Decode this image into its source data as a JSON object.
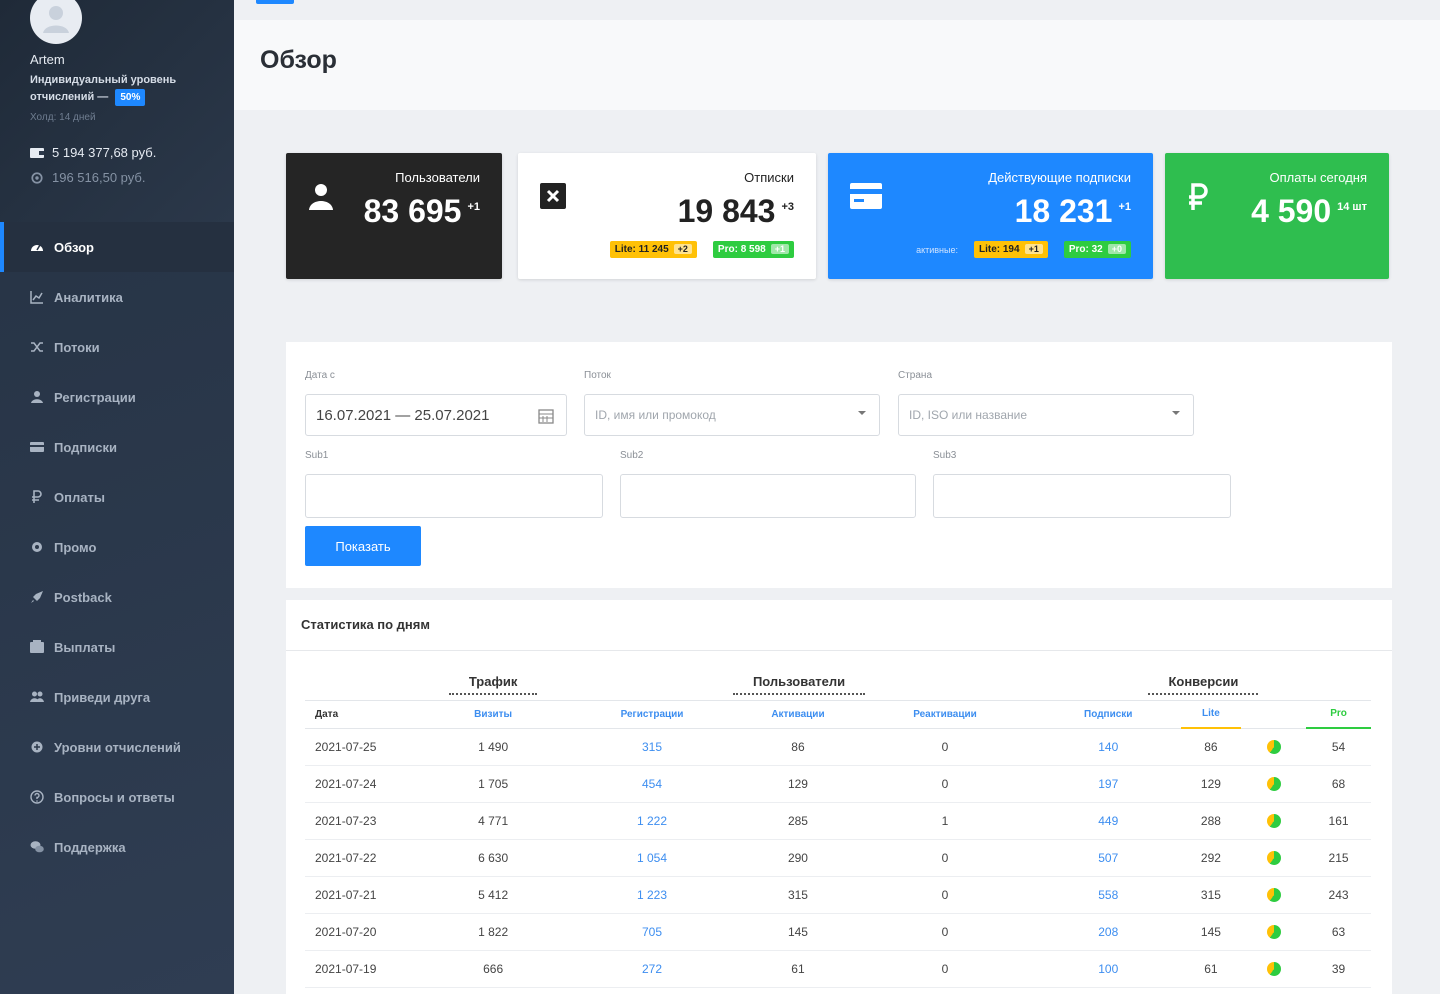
{
  "user": {
    "name": "Artem",
    "level_text": "Индивидуальный уровень отчислений —",
    "level_percent": "50%",
    "hold": "Холд: 14 дней",
    "balance_main": "5 194 377,68 руб.",
    "balance_secondary": "196 516,50 руб."
  },
  "sidebar": {
    "items": [
      {
        "label": "Обзор",
        "icon": "dashboard-icon",
        "active": true
      },
      {
        "label": "Аналитика",
        "icon": "chart-icon"
      },
      {
        "label": "Потоки",
        "icon": "shuffle-icon"
      },
      {
        "label": "Регистрации",
        "icon": "user-icon"
      },
      {
        "label": "Подписки",
        "icon": "card-icon"
      },
      {
        "label": "Оплаты",
        "icon": "ruble-icon"
      },
      {
        "label": "Промо",
        "icon": "gear-icon"
      },
      {
        "label": "Postback",
        "icon": "rocket-icon"
      },
      {
        "label": "Выплаты",
        "icon": "wallet-icon"
      },
      {
        "label": "Приведи друга",
        "icon": "users-icon"
      },
      {
        "label": "Уровни отчислений",
        "icon": "settings-icon"
      },
      {
        "label": "Вопросы и ответы",
        "icon": "question-icon"
      },
      {
        "label": "Поддержка",
        "icon": "chat-icon"
      }
    ]
  },
  "page": {
    "title": "Обзор"
  },
  "cards": {
    "users": {
      "title": "Пользователи",
      "value": "83 695",
      "delta": "+1"
    },
    "unsub": {
      "title": "Отписки",
      "value": "19 843",
      "delta": "+3",
      "lite": "Lite: 11 245",
      "lite_delta": "+2",
      "pro": "Pro: 8 598",
      "pro_delta": "+1"
    },
    "subs": {
      "title": "Действующие подписки",
      "value": "18 231",
      "delta": "+1",
      "sub_label": "активные:",
      "lite": "Lite: 194",
      "lite_delta": "+1",
      "pro": "Pro: 32",
      "pro_delta": "+0"
    },
    "pay": {
      "title": "Оплаты сегодня",
      "value": "4 590",
      "delta": "14 шт"
    }
  },
  "filters": {
    "date_label": "Дата с",
    "date_value": "16.07.2021 — 25.07.2021",
    "flow_label": "Поток",
    "flow_placeholder": "ID, имя или промокод",
    "country_label": "Страна",
    "country_placeholder": "ID, ISO или название",
    "sub1_label": "Sub1",
    "sub2_label": "Sub2",
    "sub3_label": "Sub3",
    "show_button": "Показать"
  },
  "stats": {
    "title": "Статистика по дням",
    "groups": {
      "traffic": "Трафик",
      "users": "Пользователи",
      "conversions": "Конверсии"
    },
    "columns": {
      "date": "Дата",
      "visits": "Визиты",
      "registrations": "Регистрации",
      "activations": "Активации",
      "reactivations": "Реактивации",
      "subscriptions": "Подписки",
      "lite": "Lite",
      "pro": "Pro"
    },
    "rows": [
      {
        "date": "2021-07-25",
        "visits": "1 490",
        "reg": "315",
        "act": "86",
        "react": "0",
        "subs": "140",
        "lite": "86",
        "pro": "54"
      },
      {
        "date": "2021-07-24",
        "visits": "1 705",
        "reg": "454",
        "act": "129",
        "react": "0",
        "subs": "197",
        "lite": "129",
        "pro": "68"
      },
      {
        "date": "2021-07-23",
        "visits": "4 771",
        "reg": "1 222",
        "act": "285",
        "react": "1",
        "subs": "449",
        "lite": "288",
        "pro": "161"
      },
      {
        "date": "2021-07-22",
        "visits": "6 630",
        "reg": "1 054",
        "act": "290",
        "react": "0",
        "subs": "507",
        "lite": "292",
        "pro": "215"
      },
      {
        "date": "2021-07-21",
        "visits": "5 412",
        "reg": "1 223",
        "act": "315",
        "react": "0",
        "subs": "558",
        "lite": "315",
        "pro": "243"
      },
      {
        "date": "2021-07-20",
        "visits": "1 822",
        "reg": "705",
        "act": "145",
        "react": "0",
        "subs": "208",
        "lite": "145",
        "pro": "63"
      },
      {
        "date": "2021-07-19",
        "visits": "666",
        "reg": "272",
        "act": "61",
        "react": "0",
        "subs": "100",
        "lite": "61",
        "pro": "39"
      }
    ]
  },
  "colors": {
    "accent": "#1e88ff",
    "success": "#2fbe4f",
    "warning": "#ffc107",
    "dark": "#252525"
  }
}
